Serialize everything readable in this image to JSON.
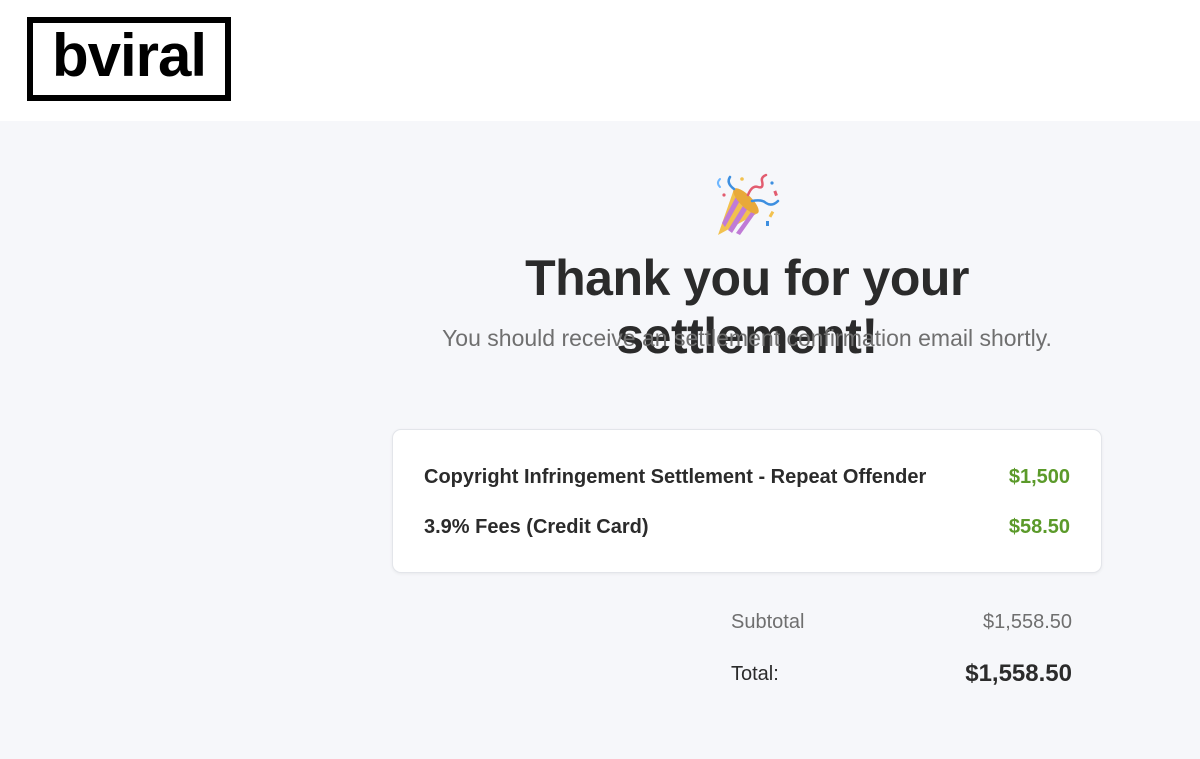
{
  "header": {
    "logo_text": "bviral"
  },
  "hero": {
    "icon": "party-popper-icon",
    "title": "Thank you for your settlement!",
    "subtitle": "You should receive an settlement confirmation email shortly."
  },
  "order": {
    "items": [
      {
        "label": "Copyright Infringement Settlement - Repeat Offender",
        "amount": "$1,500"
      },
      {
        "label": "3.9% Fees (Credit Card)",
        "amount": "$58.50"
      }
    ],
    "subtotal_label": "Subtotal",
    "subtotal_value": "$1,558.50",
    "total_label": "Total:",
    "total_value": "$1,558.50"
  },
  "colors": {
    "amount_green": "#5b9a2a",
    "page_background": "#f6f7fa",
    "text_dark": "#2b2b2b",
    "text_muted": "#6f6f6f"
  }
}
